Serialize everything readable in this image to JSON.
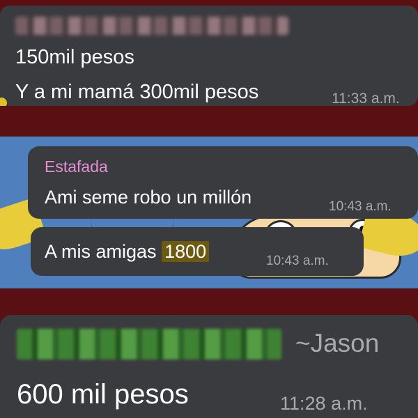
{
  "panel_top": {
    "sender_redacted": true,
    "line1": "150mil pesos",
    "line2": "Y a mi mamá 300mil pesos",
    "time": "11:33 a.m."
  },
  "panel_middle": {
    "message1": {
      "sender": "Estafada",
      "text": "Ami seme robo un millón",
      "time": "10:43 a.m."
    },
    "message2": {
      "text_prefix": "A mis amigas ",
      "highlight": "1800",
      "time": "10:43 a.m."
    }
  },
  "panel_bottom": {
    "sender_redacted": true,
    "author": "~Jason",
    "text": "600 mil pesos",
    "time": "11:28 a.m."
  },
  "colors": {
    "background_maroon": "#5a0f12",
    "bubble": "#3a3b3f",
    "sender_pink": "#e58fd7",
    "timestamp_gray": "#a9aaae",
    "highlight": "#6d5a12",
    "wallpaper_blue": "#4f7fbd"
  }
}
